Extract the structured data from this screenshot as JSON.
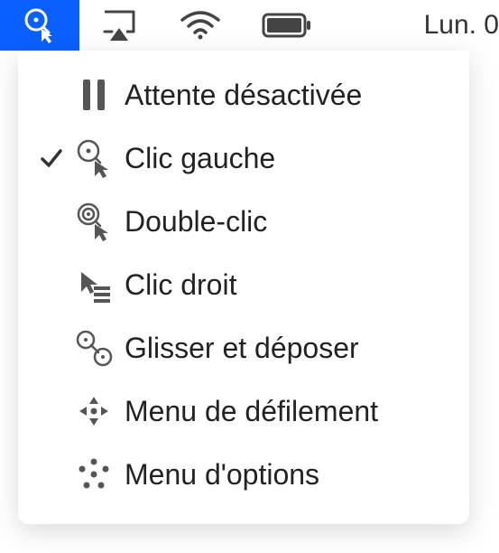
{
  "menubar": {
    "date": "Lun. 0"
  },
  "menu": {
    "items": [
      {
        "label": "Attente désactivée",
        "checked": false,
        "icon": "pause-icon"
      },
      {
        "label": "Clic gauche",
        "checked": true,
        "icon": "left-click-icon"
      },
      {
        "label": "Double-clic",
        "checked": false,
        "icon": "double-click-icon"
      },
      {
        "label": "Clic droit",
        "checked": false,
        "icon": "right-click-icon"
      },
      {
        "label": "Glisser et déposer",
        "checked": false,
        "icon": "drag-drop-icon"
      },
      {
        "label": "Menu de défilement",
        "checked": false,
        "icon": "scroll-menu-icon"
      },
      {
        "label": "Menu d'options",
        "checked": false,
        "icon": "options-menu-icon"
      }
    ]
  }
}
